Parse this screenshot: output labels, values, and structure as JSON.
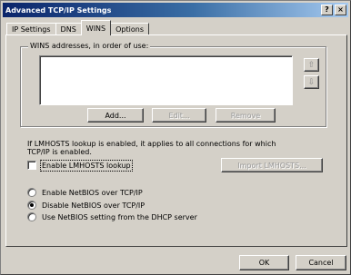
{
  "window": {
    "title": "Advanced TCP/IP Settings",
    "help_label": "?",
    "close_label": "×"
  },
  "tabs": [
    {
      "label": "IP Settings"
    },
    {
      "label": "DNS"
    },
    {
      "label": "WINS"
    },
    {
      "label": "Options"
    }
  ],
  "wins": {
    "group_label": "WINS addresses, in order of use:",
    "up_arrow": "⇧",
    "down_arrow": "⇩",
    "add_label": "Add...",
    "edit_label": "Edit...",
    "remove_label": "Remove"
  },
  "lmhosts": {
    "info_text": "If LMHOSTS lookup is enabled, it applies to all connections for which TCP/IP is enabled.",
    "enable_label": "Enable LMHOSTS lookup",
    "import_label": "Import LMHOSTS..."
  },
  "netbios": {
    "options": [
      {
        "label": "Enable NetBIOS over TCP/IP",
        "checked": false
      },
      {
        "label": "Disable NetBIOS over TCP/IP",
        "checked": true
      },
      {
        "label": "Use NetBIOS setting from the DHCP server",
        "checked": false
      }
    ]
  },
  "footer": {
    "ok_label": "OK",
    "cancel_label": "Cancel"
  }
}
